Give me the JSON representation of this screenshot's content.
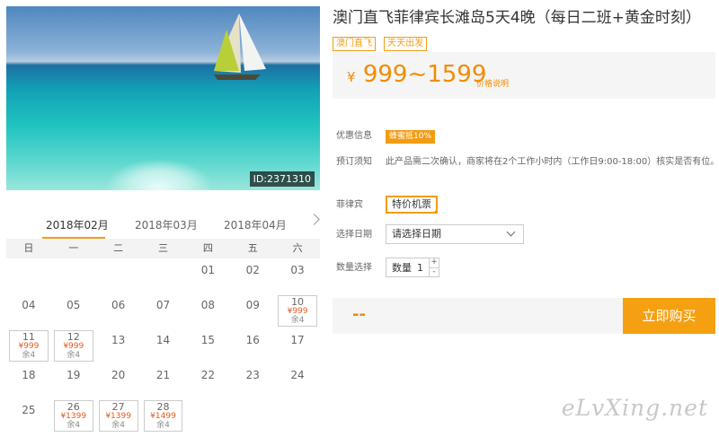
{
  "photo": {
    "id_label": "ID:2371310"
  },
  "calendar": {
    "months": [
      "2018年02月",
      "2018年03月",
      "2018年04月"
    ],
    "active_month_index": 0,
    "weekdays": [
      "日",
      "一",
      "二",
      "三",
      "四",
      "五",
      "六"
    ],
    "cells": [
      {
        "day": ""
      },
      {
        "day": ""
      },
      {
        "day": ""
      },
      {
        "day": ""
      },
      {
        "day": "01"
      },
      {
        "day": "02"
      },
      {
        "day": "03"
      },
      {
        "day": "04"
      },
      {
        "day": "05"
      },
      {
        "day": "06"
      },
      {
        "day": "07"
      },
      {
        "day": "08"
      },
      {
        "day": "09"
      },
      {
        "day": "10",
        "price": "¥999",
        "stock": "余4"
      },
      {
        "day": "11",
        "price": "¥999",
        "stock": "余4"
      },
      {
        "day": "12",
        "price": "¥999",
        "stock": "余4"
      },
      {
        "day": "13"
      },
      {
        "day": "14"
      },
      {
        "day": "15"
      },
      {
        "day": "16"
      },
      {
        "day": "17"
      },
      {
        "day": "18"
      },
      {
        "day": "19"
      },
      {
        "day": "20"
      },
      {
        "day": "21"
      },
      {
        "day": "22"
      },
      {
        "day": "23"
      },
      {
        "day": "24"
      },
      {
        "day": "25"
      },
      {
        "day": "26",
        "price": "¥1399",
        "stock": "余4"
      },
      {
        "day": "27",
        "price": "¥1399",
        "stock": "余4"
      },
      {
        "day": "28",
        "price": "¥1499",
        "stock": "余4"
      }
    ]
  },
  "product": {
    "title": "澳门直飞菲律宾长滩岛5天4晚（每日二班+黄金时刻）",
    "tags": [
      "澳门直飞",
      "天天出发"
    ],
    "price_currency": "¥",
    "price_range": "999~1599",
    "price_note": "价格说明"
  },
  "info": {
    "promo_label": "优惠信息",
    "promo_badge": "蜂蜜抵10%",
    "notice_label": "预订须知",
    "notice_text": "此产品需二次确认，商家将在2个工作小时内（工作日9:00-18:00）核实是否有位。"
  },
  "options": {
    "type_label": "菲律宾",
    "type_value": "特价机票",
    "date_label": "选择日期",
    "date_placeholder": "请选择日期",
    "qty_label": "数量选择",
    "qty_prefix": "数量",
    "qty_value": "1",
    "plus": "+",
    "minus": "-"
  },
  "buy": {
    "total": "--",
    "button": "立即购买"
  },
  "watermark": "eLvXing.net",
  "colors": {
    "accent": "#f39c12",
    "price": "#f38b00",
    "buy_button": "#f5a011"
  }
}
